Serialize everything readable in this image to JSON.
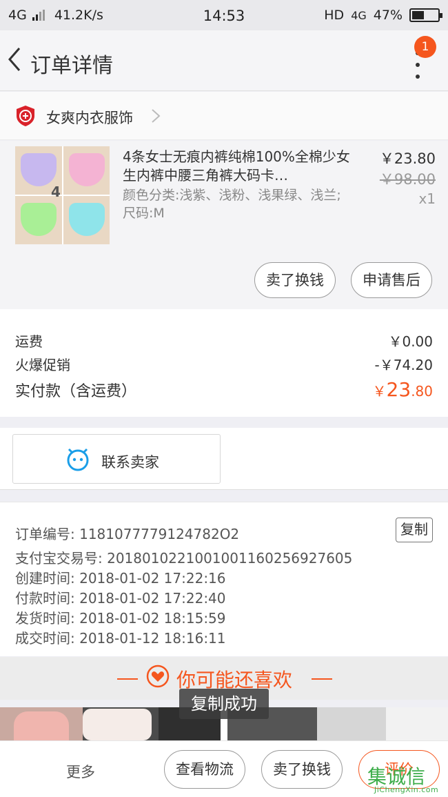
{
  "status_bar": {
    "network": "4G",
    "speed": "41.2K/s",
    "time": "14:53",
    "hd": "HD",
    "net_right": "4G",
    "battery": "47%",
    "battery_level": 0.47
  },
  "nav": {
    "title": "订单详情",
    "badge": "1"
  },
  "shop": {
    "name": "女爽内衣服饰"
  },
  "product": {
    "title": "4条女士无痕内裤纯棉100%全棉少女生内裤中腰三角裤大码卡…",
    "attrs": "颜色分类:浅紫、浅粉、浅果绿、浅兰;尺码:M",
    "price": "￥23.80",
    "original_price": "￥98.00",
    "qty": "x1",
    "thumb_label": "4",
    "buttons": {
      "sell": "卖了换钱",
      "after_sale": "申请售后"
    }
  },
  "costs": {
    "shipping_label": "运费",
    "shipping_value": "￥0.00",
    "promo_label": "火爆促销",
    "promo_value": "-￥74.20",
    "total_label": "实付款（含运费）",
    "total_currency": "￥",
    "total_int": "23",
    "total_dec": ".80"
  },
  "contact": {
    "label": "联系卖家"
  },
  "order_info": {
    "order_no": "订单编号: 1181077779124782O2",
    "alipay_no": "支付宝交易号: 2018010221001001160256927605",
    "created": "创建时间: 2018-01-02 17:22:16",
    "paid": "付款时间: 2018-01-02 17:22:40",
    "shipped": "发货时间: 2018-01-02 18:15:59",
    "completed": "成交时间: 2018-01-12 18:16:11",
    "copy_label": "复制"
  },
  "recommend": {
    "title": "你可能还喜欢"
  },
  "toast": {
    "text": "复制成功"
  },
  "bottom": {
    "more": "更多",
    "logistics": "查看物流",
    "sell": "卖了换钱",
    "review": "评价"
  },
  "watermark": {
    "text": "集诚信",
    "sub": "JiChengXin.com"
  },
  "colors": {
    "accent": "#f5561e",
    "shop_logo": "#d9222a",
    "contact_icon": "#1a9ee8"
  }
}
